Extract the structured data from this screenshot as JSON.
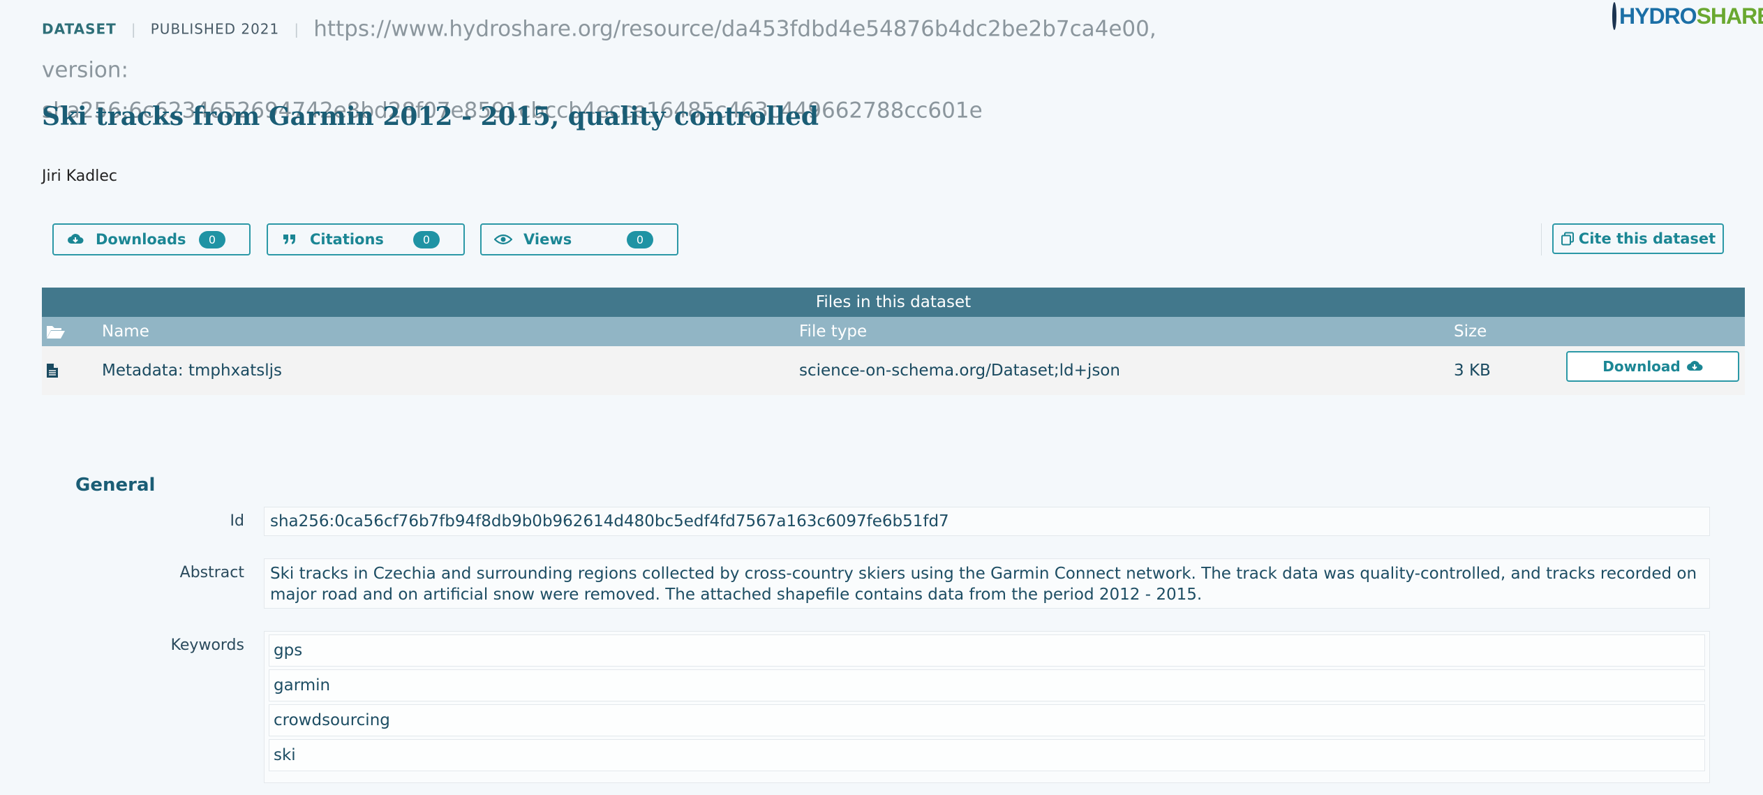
{
  "header": {
    "type_label": "DATASET",
    "published_label": "PUBLISHED 2021",
    "identifier_line1": "https://www.hydroshare.org/resource/da453fdbd4e54876b4dc2be2b7ca4e00, version:",
    "identifier_line2": "sha256:6c6234652694742e8bd28f07e8591cbccb4ecce16485c463c449662788cc601e",
    "logo_hydro": "HYDRO",
    "logo_share": "SHARE"
  },
  "dataset": {
    "title": "Ski tracks from Garmin 2012 - 2015, quality controlled",
    "author": "Jiri Kadlec"
  },
  "stats": {
    "downloads": {
      "label": "Downloads",
      "count": "0",
      "icon": "cloud-download-icon"
    },
    "citations": {
      "label": "Citations",
      "count": "0",
      "icon": "quote-icon"
    },
    "views": {
      "label": "Views",
      "count": "0",
      "icon": "eye-icon"
    }
  },
  "cite_button": {
    "label": "Cite this dataset",
    "icon": "copy-icon"
  },
  "files": {
    "heading": "Files in this dataset",
    "columns": {
      "name": "Name",
      "type": "File type",
      "size": "Size"
    },
    "rows": [
      {
        "name": "Metadata: tmphxatsljs",
        "type": "science-on-schema.org/Dataset;ld+json",
        "size": "3 KB",
        "download_label": "Download"
      }
    ]
  },
  "general": {
    "heading": "General",
    "id_label": "Id",
    "id_value": "sha256:0ca56cf76b7fb94f8db9b0b962614d480bc5edf4fd7567a163c6097fe6b51fd7",
    "abstract_label": "Abstract",
    "abstract_value": "Ski tracks in Czechia and surrounding regions collected by cross-country skiers using the Garmin Connect network. The track data was quality-controlled, and tracks recorded on major road and on artificial snow were removed. The attached shapefile contains data from the period 2012 - 2015.",
    "keywords_label": "Keywords",
    "keywords": [
      "gps",
      "garmin",
      "crowdsourcing",
      "ski"
    ]
  },
  "colors": {
    "accent": "#1f93a4",
    "title": "#1a5d75",
    "table_header": "#42788c",
    "table_columns": "#91b5c5"
  }
}
